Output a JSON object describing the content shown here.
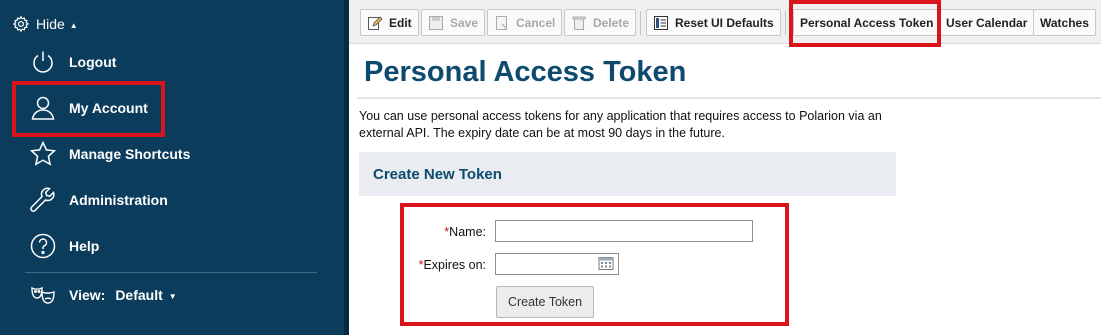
{
  "sidebar": {
    "hide_label": "Hide",
    "items": [
      {
        "label": "Logout",
        "icon": "power-icon"
      },
      {
        "label": "My Account",
        "icon": "user-icon"
      },
      {
        "label": "Manage Shortcuts",
        "icon": "star-icon"
      },
      {
        "label": "Administration",
        "icon": "wrench-icon"
      },
      {
        "label": "Help",
        "icon": "help-icon"
      }
    ],
    "view_label": "View:",
    "view_value": "Default"
  },
  "toolbar": {
    "edit": "Edit",
    "save": "Save",
    "cancel": "Cancel",
    "delete": "Delete",
    "reset": "Reset UI Defaults",
    "token": "Personal Access Token",
    "calendar": "User Calendar",
    "watches": "Watches"
  },
  "page": {
    "title": "Personal Access Token",
    "description": "You can use personal access tokens for any application that requires access to Polarion via an external API. The expiry date can be at most 90 days in the future.",
    "section_title": "Create New Token"
  },
  "form": {
    "required_mark": "*",
    "name_label": "Name:",
    "name_value": "",
    "expires_label": "Expires on:",
    "expires_value": "",
    "create_button": "Create Token"
  },
  "colors": {
    "sidebar_bg": "#0c3c5c",
    "title_color": "#0d4a6e",
    "highlight": "#d9141b",
    "required": "#c4161c"
  }
}
